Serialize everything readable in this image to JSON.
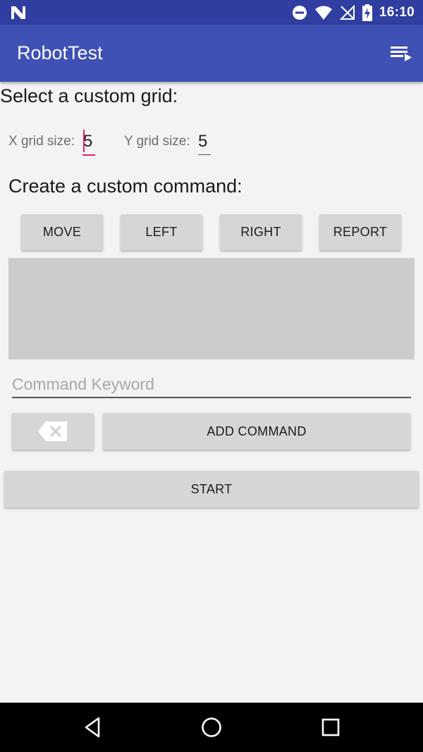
{
  "status_bar": {
    "time": "16:10",
    "icons": [
      "notification-n-icon",
      "do-not-disturb-icon",
      "wifi-icon",
      "no-signal-icon",
      "battery-charging-icon"
    ]
  },
  "app_bar": {
    "title": "RobotTest",
    "menu_icon": "menu-list-icon"
  },
  "grid": {
    "heading": "Select a custom grid:",
    "x_label": "X grid size:",
    "x_value": "5",
    "y_label": "Y grid size:",
    "y_value": "5"
  },
  "command": {
    "heading": "Create a custom command:",
    "buttons": [
      "MOVE",
      "LEFT",
      "RIGHT",
      "REPORT"
    ],
    "keyword_placeholder": "Command Keyword",
    "keyword_value": "",
    "backspace_icon": "backspace-icon",
    "add_label": "ADD COMMAND"
  },
  "start_label": "START",
  "colors": {
    "status_bar": "#2f3ea0",
    "app_bar": "#3f51b5",
    "accent": "#e91e63",
    "button": "#d6d6d6",
    "command_area": "#cdcccd"
  },
  "nav_bar": {
    "icons": [
      "back-icon",
      "home-icon",
      "recents-icon"
    ]
  }
}
